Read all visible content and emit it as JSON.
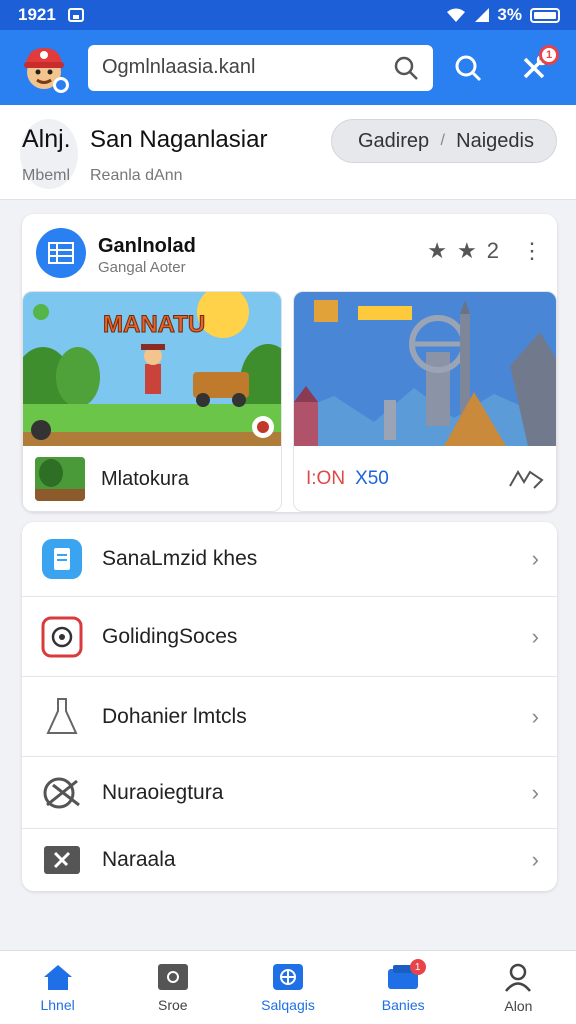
{
  "status_bar": {
    "time": "1921",
    "battery": "3%"
  },
  "header": {
    "search_value": "Ogmlnlaasia.kanl",
    "notification_count": "1"
  },
  "profile": {
    "abbr": "Alnj.",
    "name": "San Naganlasiar",
    "sub_left": "Mbeml",
    "sub_right": "Reanla dAnn",
    "pill_left": "Gadirep",
    "pill_sep": "/",
    "pill_right": "Naigedis"
  },
  "card": {
    "title": "Ganlnolad",
    "subtitle": "Gangal Aoter",
    "rating_count": "2",
    "tile1": {
      "banner": "MANATU",
      "caption": "Mlatokura"
    },
    "tile2": {
      "caption_red": "I:ON",
      "caption_blue": "X50"
    }
  },
  "list": {
    "items": [
      {
        "label": "SanaLmzid khes",
        "icon": "document-icon",
        "color": "#3aa4f0"
      },
      {
        "label": "GolidingSoces",
        "icon": "target-icon",
        "color": "#d93a3a"
      },
      {
        "label": "Dohanier lmtcls",
        "icon": "flask-icon",
        "color": "#666666"
      },
      {
        "label": "Nuraoiegtura",
        "icon": "tools-icon",
        "color": "#555555"
      },
      {
        "label": "Naraala",
        "icon": "hammer-icon",
        "color": "#555555"
      }
    ]
  },
  "bottom_nav": {
    "items": [
      {
        "label": "Lhnel",
        "icon": "home-icon",
        "active": true
      },
      {
        "label": "Sroe",
        "icon": "store-icon",
        "active": false
      },
      {
        "label": "Salqagis",
        "icon": "games-icon",
        "active": true
      },
      {
        "label": "Banies",
        "icon": "inbox-icon",
        "active": true,
        "badge": "1"
      },
      {
        "label": "Alon",
        "icon": "profile-icon",
        "active": false
      }
    ]
  },
  "colors": {
    "primary": "#2a7ff1",
    "status_bar": "#1d5fd6",
    "accent_red": "#e9434a"
  }
}
